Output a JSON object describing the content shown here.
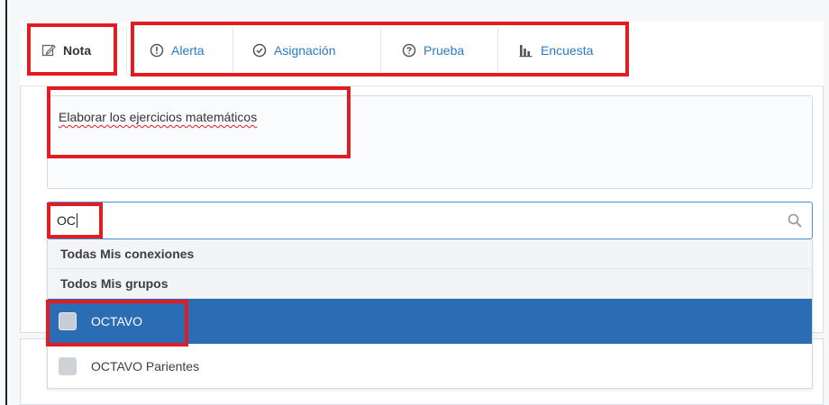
{
  "tabs": [
    {
      "label": "Nota",
      "icon": "edit-icon",
      "active": true
    },
    {
      "label": "Alerta",
      "icon": "alert-circle-icon",
      "active": false
    },
    {
      "label": "Asignación",
      "icon": "check-circle-icon",
      "active": false
    },
    {
      "label": "Prueba",
      "icon": "question-circle-icon",
      "active": false
    },
    {
      "label": "Encuesta",
      "icon": "bar-chart-icon",
      "active": false
    }
  ],
  "message": {
    "text": "Elaborar los ejercicios matemáticos"
  },
  "recipients_search": {
    "value": "OC"
  },
  "dropdown": {
    "group_connections": "Todas Mis conexiones",
    "group_groups": "Todos Mis grupos",
    "options": [
      {
        "label": "OCTAVO",
        "selected": true
      },
      {
        "label": "OCTAVO Parientes",
        "selected": false
      }
    ]
  },
  "colors": {
    "accent": "#2b7bc2",
    "selected_row": "#2a6db4",
    "highlight": "#e31b23"
  }
}
